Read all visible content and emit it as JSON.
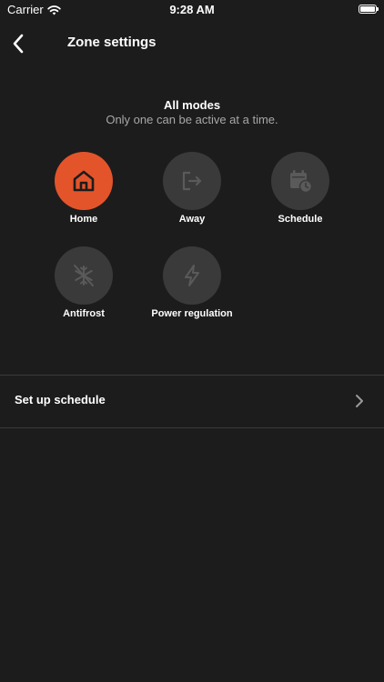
{
  "status": {
    "carrier": "Carrier",
    "time": "9:28 AM"
  },
  "nav": {
    "title": "Zone settings"
  },
  "header": {
    "title": "All modes",
    "subtitle": "Only one can be active at a time."
  },
  "modes": [
    {
      "label": "Home",
      "icon": "home-icon",
      "active": true
    },
    {
      "label": "Away",
      "icon": "exit-icon",
      "active": false
    },
    {
      "label": "Schedule",
      "icon": "calendar-clock-icon",
      "active": false
    },
    {
      "label": "Antifrost",
      "icon": "snowflake-off-icon",
      "active": false
    },
    {
      "label": "Power regulation",
      "icon": "lightning-icon",
      "active": false
    }
  ],
  "setup": {
    "label": "Set up schedule"
  },
  "colors": {
    "background": "#1c1c1c",
    "accent": "#e4542b",
    "inactive_circle": "#3a3a3a",
    "muted_text": "#a7a7a7"
  }
}
